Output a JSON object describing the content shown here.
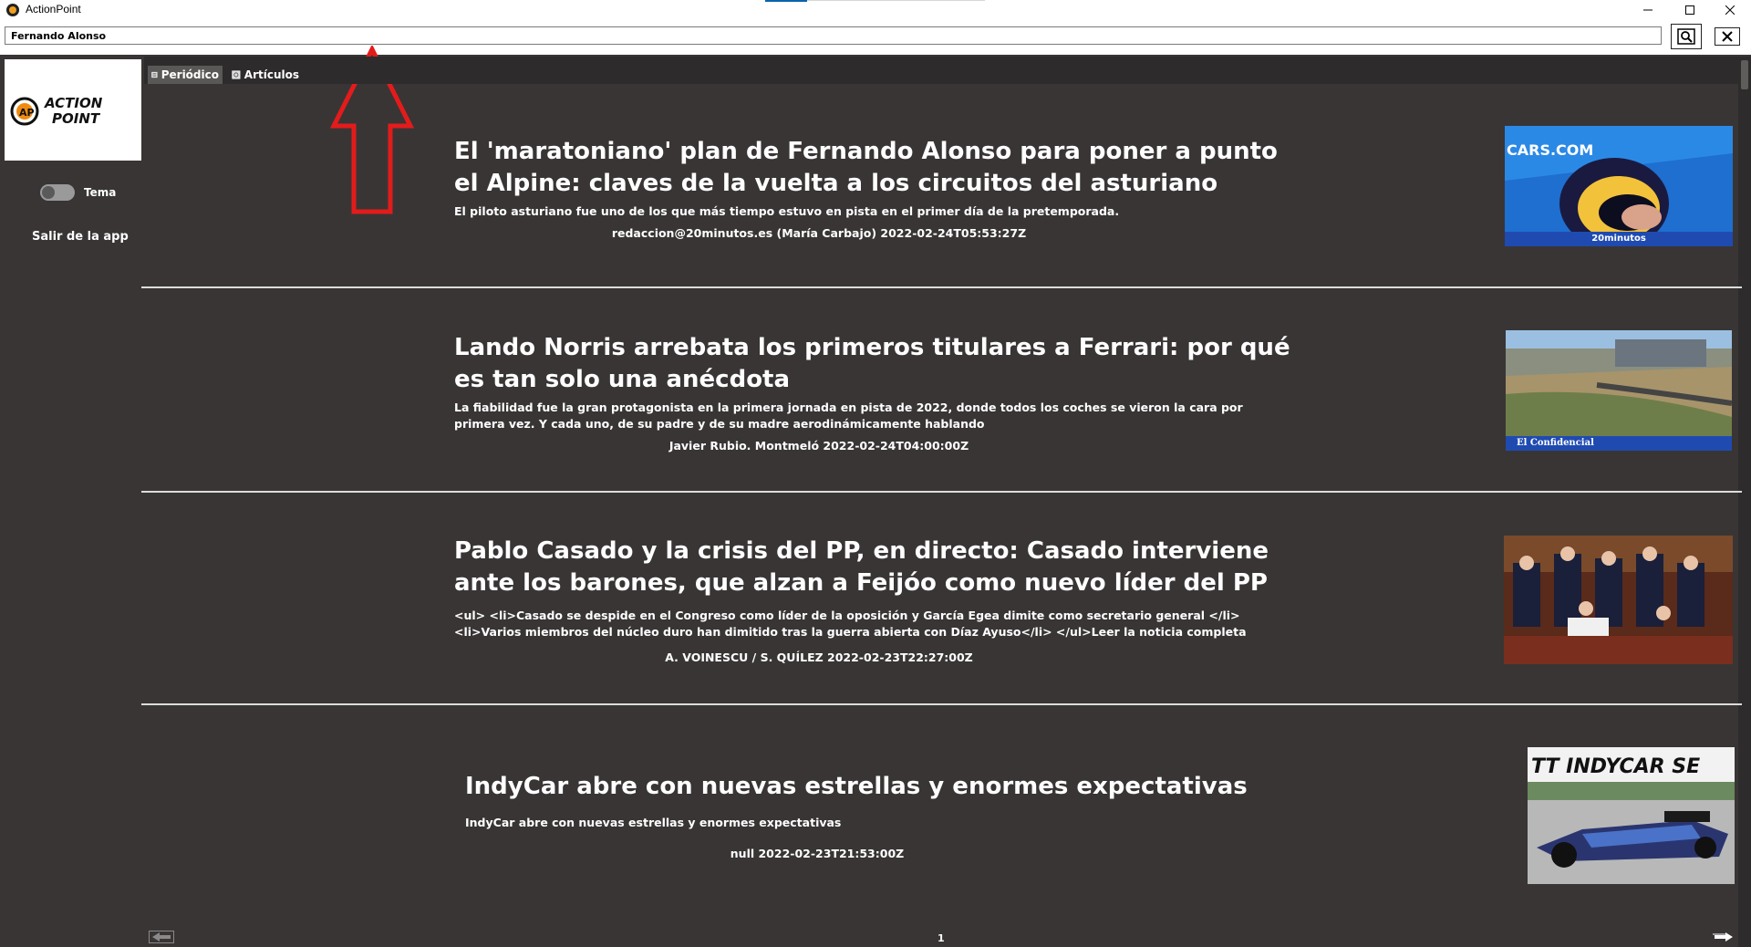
{
  "window": {
    "title": "ActionPoint",
    "icons": [
      "app-icon",
      "minimize-icon",
      "maximize-icon",
      "close-icon"
    ]
  },
  "search": {
    "value": "Fernando Alonso",
    "icons": [
      "search-icon",
      "clear-icon"
    ]
  },
  "sidebar": {
    "logo_text": "ACTION POINT",
    "theme_label": "Tema",
    "exit_label": "Salir de la app"
  },
  "tabs": [
    {
      "label": "Periódico",
      "icon": "newspaper-icon",
      "active": true
    },
    {
      "label": "Artículos",
      "icon": "article-icon",
      "active": false
    }
  ],
  "articles": [
    {
      "title_line1": "El 'maratoniano' plan de Fernando Alonso para poner a punto",
      "title_line2": "el Alpine: claves de la vuelta a los circuitos del asturiano",
      "desc_line1": "El piloto asturiano fue uno de los que más tiempo estuvo en pista en el primer día de la pretemporada.",
      "desc_line2": "",
      "meta": "redaccion@20minutos.es (María Carbajo) 2022-02-24T05:53:27Z",
      "image_caption": "20minutos"
    },
    {
      "title_line1": "Lando Norris arrebata los primeros titulares a Ferrari: por qué",
      "title_line2": "es tan solo una anécdota",
      "desc_line1": "La fiabilidad fue la gran protagonista en la primera jornada en pista de 2022, donde todos los coches se vieron la cara por",
      "desc_line2": "primera vez. Y cada uno, de su padre y de su madre aerodinámicamente hablando",
      "meta": "Javier Rubio. Montmeló 2022-02-24T04:00:00Z",
      "image_caption": "El Confidencial"
    },
    {
      "title_line1": "Pablo Casado y la crisis del PP, en directo: Casado interviene",
      "title_line2": "ante los barones, que alzan a Feijóo como nuevo líder del PP",
      "desc_line1": "<ul> <li>Casado se despide en el Congreso como líder de la oposición y García Egea dimite como secretario general </li>",
      "desc_line2": "<li>Varios miembros del núcleo duro han dimitido tras la guerra abierta con Díaz Ayuso</li> </ul>Leer la noticia completa",
      "meta": "A. VOINESCU / S. QUÍLEZ 2022-02-23T22:27:00Z",
      "image_caption": ""
    },
    {
      "title_line1": "IndyCar abre con nuevas estrellas y enormes expectativas",
      "title_line2": "",
      "desc_line1": "IndyCar abre con nuevas estrellas y enormes expectativas",
      "desc_line2": "",
      "meta": "null 2022-02-23T21:53:00Z",
      "image_caption": "",
      "image_banner": "TT INDYCAR SE"
    }
  ],
  "image_texts": {
    "cars_banner": "CARS.COM"
  },
  "pagination": {
    "page": "1",
    "icons": [
      "prev-arrow-icon",
      "next-arrow-icon"
    ]
  }
}
